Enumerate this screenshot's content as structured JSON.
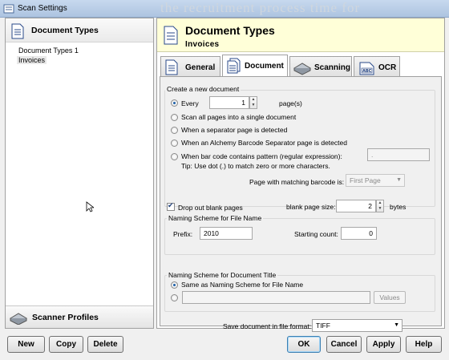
{
  "window": {
    "title": "Scan Settings",
    "background_text": "the recruitment process time for"
  },
  "left": {
    "header": "Document Types",
    "tree": [
      "Document Types 1",
      "Invoices"
    ],
    "footer": "Scanner Profiles",
    "buttons": {
      "new": "New",
      "copy": "Copy",
      "delete": "Delete"
    }
  },
  "right": {
    "title": "Document Types",
    "subtitle": "Invoices",
    "tabs": [
      "General",
      "Document",
      "Scanning",
      "OCR"
    ],
    "active_tab": "Document"
  },
  "create": {
    "group_label": "Create a new document",
    "every_label": "Every",
    "every_value": "1",
    "pages_suffix": "page(s)",
    "opt_single": "Scan all pages into a single document",
    "opt_separator": "When a separator page is detected",
    "opt_alchemy": "When an Alchemy Barcode Separator page is detected",
    "opt_barcode": "When bar code contains pattern (regular expression):",
    "pattern_value": ".",
    "tip": "Tip: Use dot (.) to match zero or more characters.",
    "matching_label": "Page with matching barcode is:",
    "matching_value": "First Page"
  },
  "blank": {
    "drop_label": "Drop out blank pages",
    "size_label": "blank page size:",
    "size_value": "2",
    "size_unit": "bytes"
  },
  "naming_file": {
    "group_label": "Naming Scheme for File Name",
    "prefix_label": "Prefix:",
    "prefix_value": "2010",
    "count_label": "Starting count:",
    "count_value": "0"
  },
  "naming_title": {
    "group_label": "Naming Scheme for Document Title",
    "same_label": "Same as Naming Scheme for File Name",
    "values_button": "Values"
  },
  "save": {
    "label": "Save document in file format:",
    "value": "TIFF"
  },
  "dialog_buttons": {
    "ok": "OK",
    "cancel": "Cancel",
    "apply": "Apply",
    "help": "Help"
  },
  "colors": {
    "header_bg": "#ffffd8",
    "title_bar": "#c7d9ee",
    "radio_dot": "#1c5fa8"
  }
}
